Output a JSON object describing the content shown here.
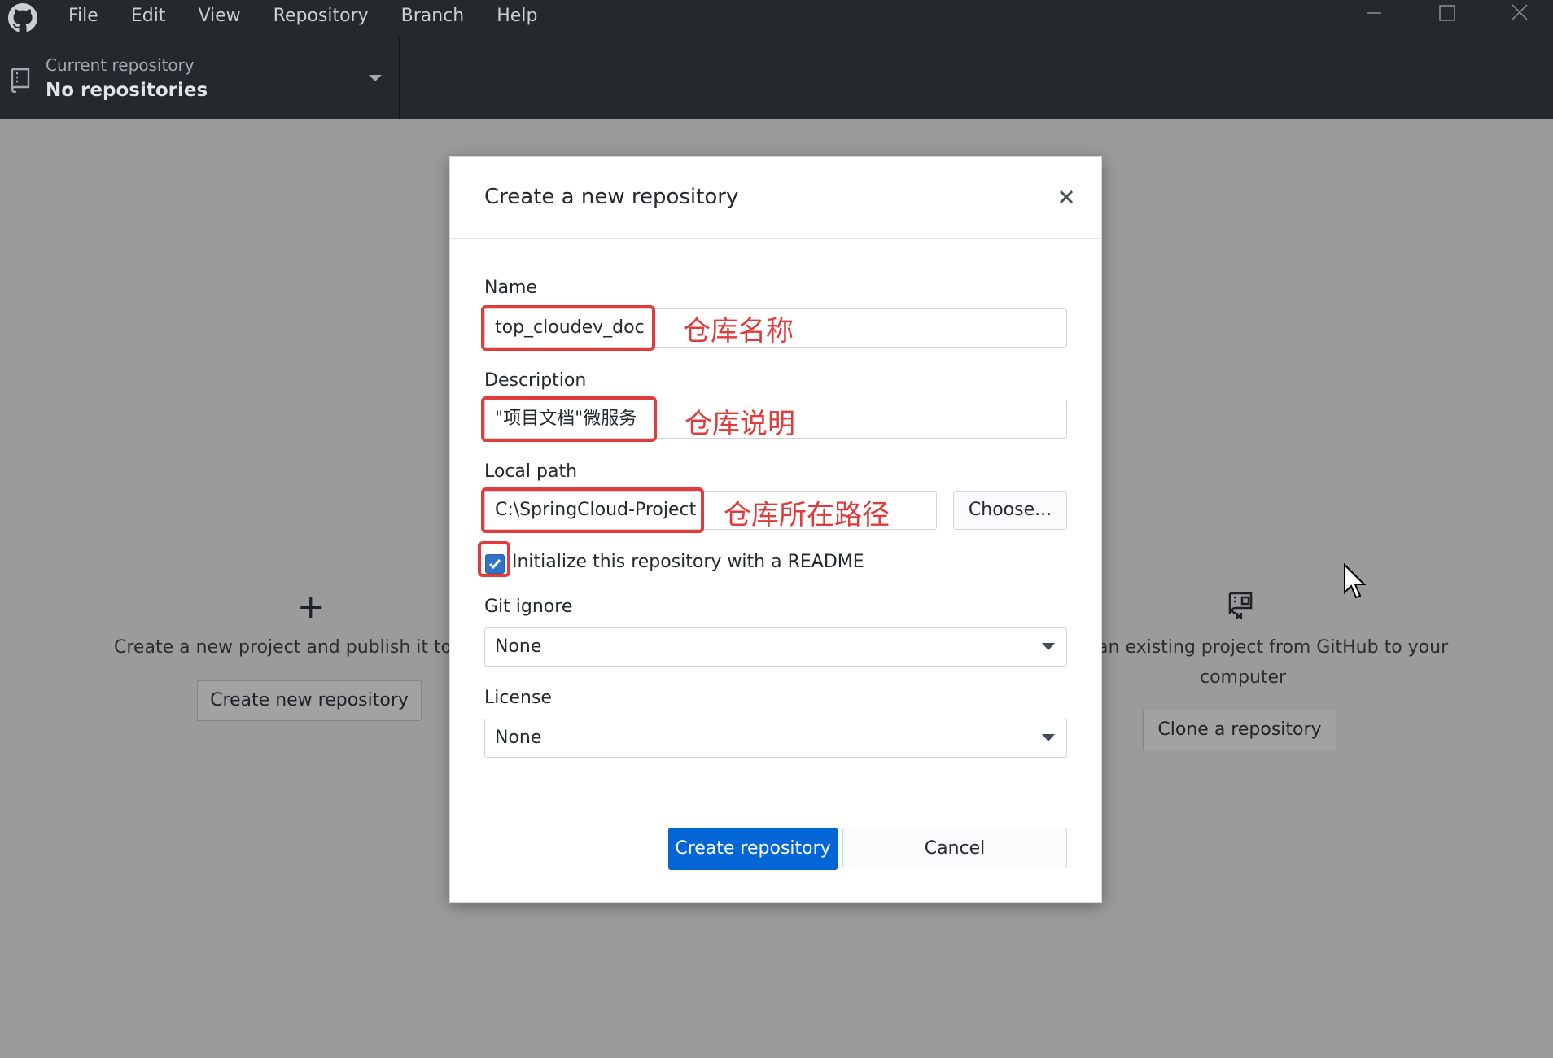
{
  "menu": [
    "File",
    "Edit",
    "View",
    "Repository",
    "Branch",
    "Help"
  ],
  "toolbar": {
    "repo_label": "Current repository",
    "repo_value": "No repositories"
  },
  "background": {
    "left_icon": "+",
    "left_description": "Create a new project and publish it to G",
    "left_button": "Create new repository",
    "right_description_line1": "an existing project from GitHub to your",
    "right_description_line2": "computer",
    "right_button": "Clone a repository"
  },
  "dialog": {
    "title": "Create a new repository",
    "name_label": "Name",
    "name_value": "top_cloudev_doc",
    "name_annotation": "仓库名称",
    "description_label": "Description",
    "description_value": "\"项目文档\"微服务",
    "description_annotation": "仓库说明",
    "local_path_label": "Local path",
    "local_path_value": "C:\\SpringCloud-Project",
    "local_path_annotation": "仓库所在路径",
    "choose_button": "Choose...",
    "readme_label": "Initialize this repository with a README",
    "readme_checked": true,
    "gitignore_label": "Git ignore",
    "gitignore_value": "None",
    "license_label": "License",
    "license_value": "None",
    "create_button": "Create repository",
    "cancel_button": "Cancel"
  },
  "colors": {
    "titlebar": "#24292e",
    "overlay": "#9b9b9b",
    "primary": "#0366d6",
    "annotation_red": "#e23b3b"
  },
  "icons": [
    "github-logo-icon",
    "minimize-icon",
    "maximize-icon",
    "close-window-icon",
    "repo-icon",
    "chevron-down-icon",
    "plus-icon",
    "clone-icon",
    "close-icon",
    "checkmark-icon",
    "mouse-cursor-icon"
  ]
}
